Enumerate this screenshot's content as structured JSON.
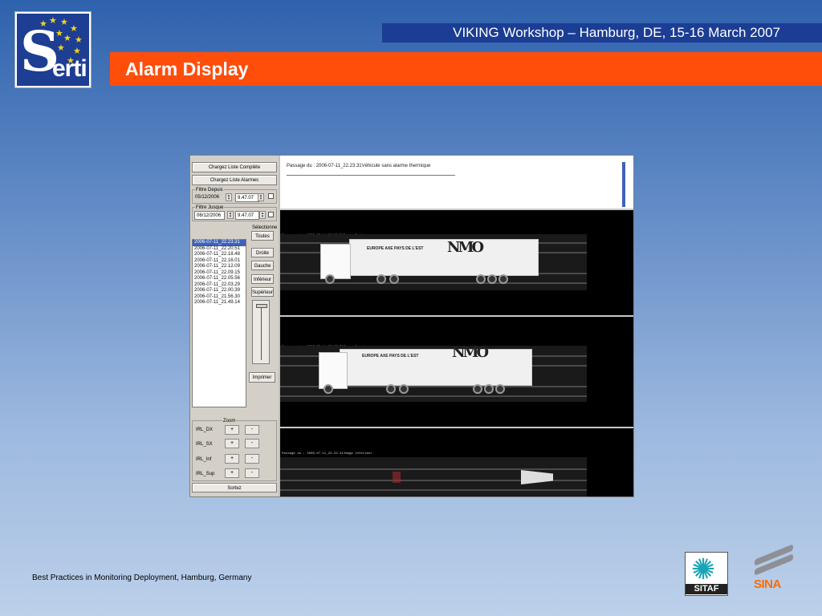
{
  "header": {
    "logo_text": "Serti",
    "event": "VIKING Workshop – Hamburg, DE, 15-16 March 2007",
    "title": "Alarm Display"
  },
  "app": {
    "buttons": {
      "load_full": "Chargez Liste Complète",
      "load_alarms": "Chargez Liste Alarmes",
      "all": "Toutes",
      "right": "Droite",
      "left": "Gauche",
      "lower": "Inférieur",
      "upper": "Supérieur",
      "print": "Imprimer",
      "exit": "Sortez"
    },
    "filter_from": {
      "label": "Filtre Depuis",
      "date": "05/12/2006",
      "time": "9.47.07"
    },
    "filter_to": {
      "label": "Filtre Jusque",
      "date": "06/12/2006",
      "time": "9.47.07"
    },
    "selection_label": "Sélectionne",
    "passages": [
      "2006-07-11_22.23.31",
      "2006-07-11_22.20.51",
      "2006-07-11_22.18.48",
      "2006-07-11_22.16.01",
      "2006-07-11_22.12.09",
      "2006-07-11_22.09.15",
      "2006-07-11_22.05.56",
      "2006-07-11_22.03.29",
      "2006-07-11_22.00.39",
      "2006-07-11_21.56.30",
      "2006-07-11_21.49.14"
    ],
    "zoom": {
      "label": "Zoom",
      "rows": [
        "IRL_DX",
        "IRL_SX",
        "IRL_Inf",
        "IRL_Sup"
      ],
      "plus": "+",
      "minus": "-"
    },
    "message": "Passage du : 2006-07-11_22.23.31Véhicule sans alarme thermique",
    "frames": [
      {
        "caption": "Passage du : 2006-07-11_22.23.31Image Droite",
        "trailer_text": "EUROPE AXE PAYS DE L'EST"
      },
      {
        "caption": "Passage du : 2006-07-11_22.23.31Image Gauche",
        "trailer_text": "EUROPE AXE PAYS DE L'EST"
      },
      {
        "caption": "Passage du : 2006-07-11_22.23.31Image Inférieur",
        "trailer_text": ""
      }
    ],
    "trailer_logo": "NMO"
  },
  "footer": {
    "text": "Best Practices in Monitoring Deployment, Hamburg, Germany",
    "sitaf": "SITAF",
    "sina": "SINA"
  }
}
